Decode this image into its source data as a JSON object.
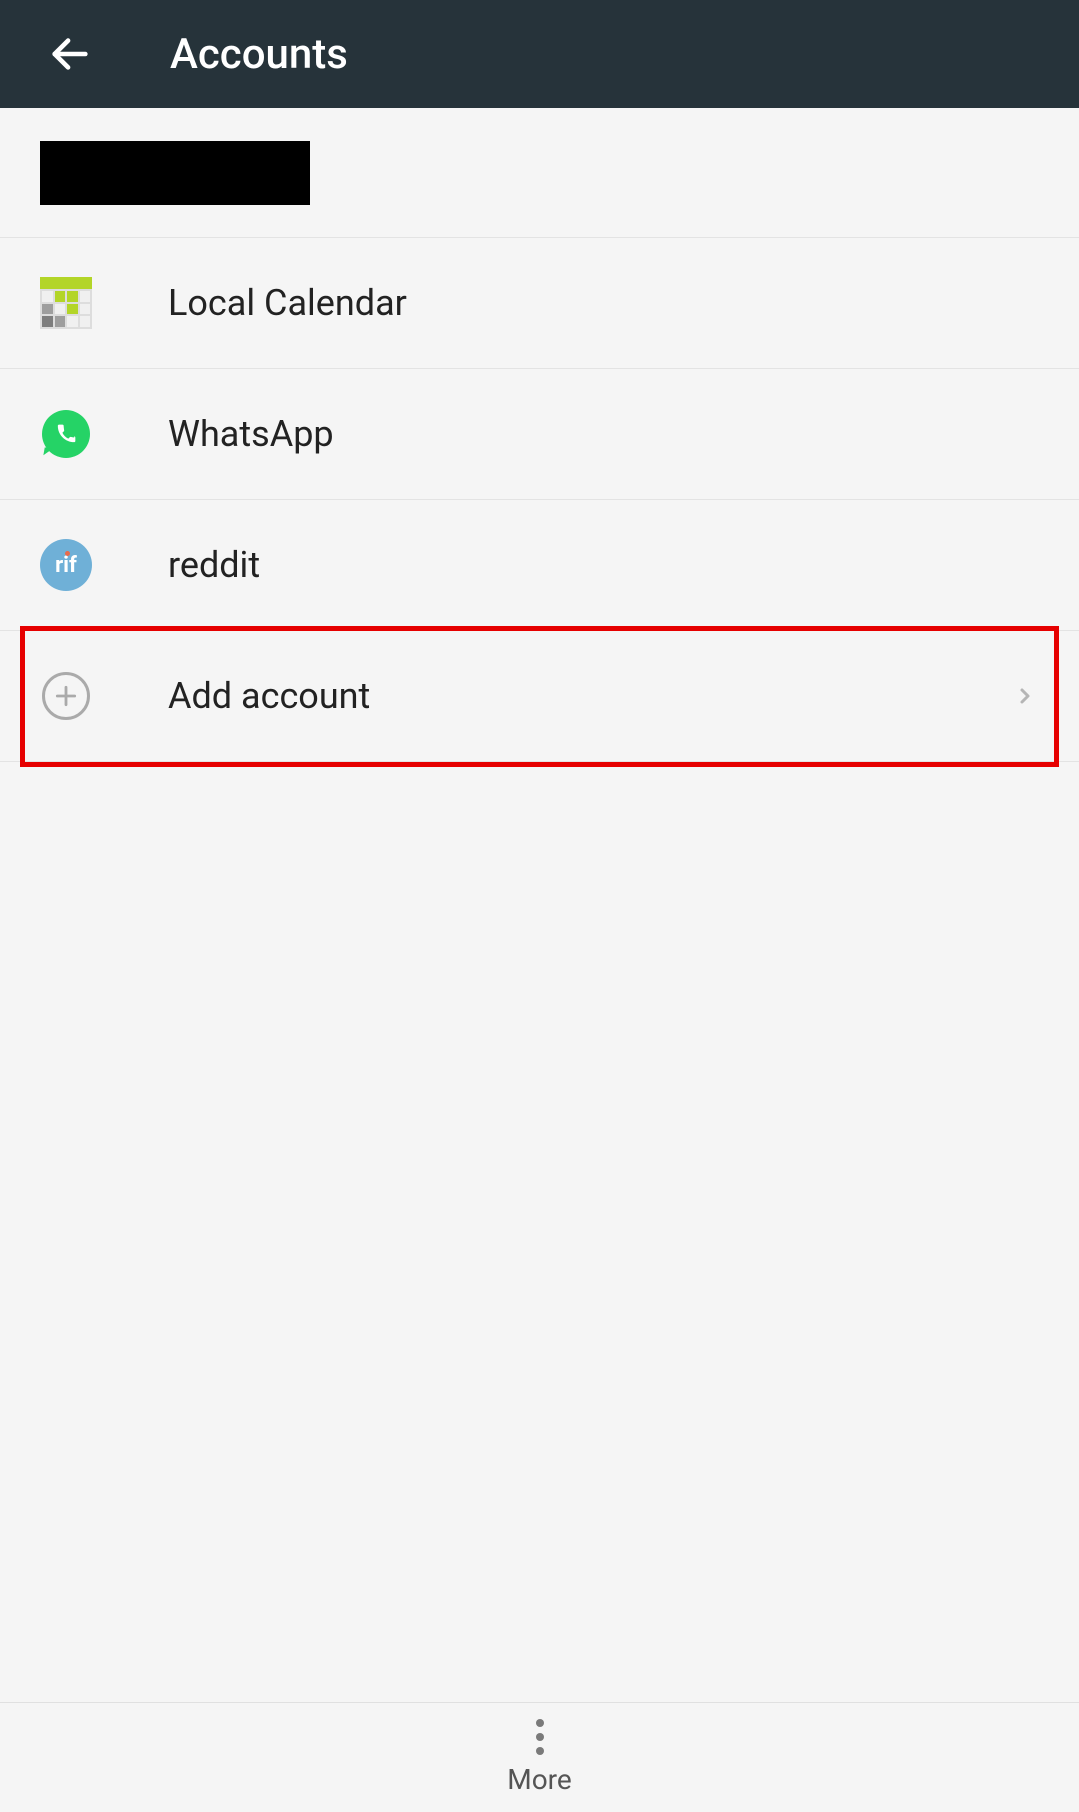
{
  "appbar": {
    "title": "Accounts"
  },
  "accounts": [
    {
      "label": "Local Calendar",
      "icon": "calendar"
    },
    {
      "label": "WhatsApp",
      "icon": "whatsapp"
    },
    {
      "label": "reddit",
      "icon": "rif"
    }
  ],
  "add_account": {
    "label": "Add account"
  },
  "bottombar": {
    "more_label": "More"
  }
}
